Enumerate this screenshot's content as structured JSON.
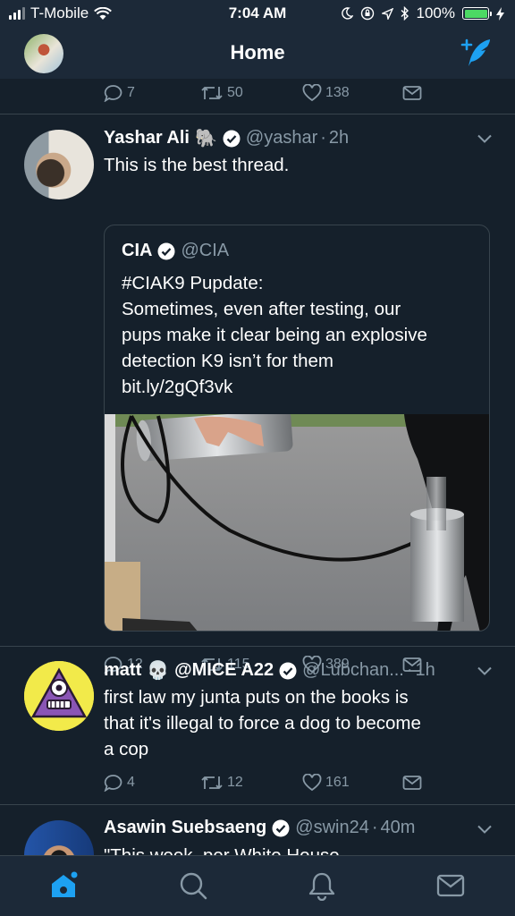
{
  "status_bar": {
    "carrier": "T-Mobile",
    "time": "7:04 AM",
    "battery": "100%"
  },
  "nav": {
    "title": "Home",
    "avatar": "profile-avatar",
    "compose_icon": "compose-tweet-icon"
  },
  "top_partial_actions": {
    "replies": "7",
    "retweets": "50",
    "likes": "138"
  },
  "tweets": [
    {
      "name": "Yashar Ali",
      "emoji": "🐘",
      "handle": "@yashar",
      "time": "2h",
      "text": "This is the best thread.",
      "quote": {
        "name": "CIA",
        "handle": "@CIA",
        "text_lines": [
          "#CIAK9 Pupdate:",
          "Sometimes, even after testing, our",
          "pups make it clear being an explosive",
          "detection K9 isn’t for them",
          "bit.ly/2gQf3vk"
        ]
      },
      "replies": "12",
      "retweets": "115",
      "likes": "389"
    },
    {
      "name": "matt",
      "emoji": "💀",
      "name2": "@MICE A22",
      "handle": "@Lubchan...",
      "time": "1h",
      "text_lines": [
        "first law my junta puts on the books is",
        "that it's illegal to force a dog to become",
        "a cop"
      ],
      "replies": "4",
      "retweets": "12",
      "likes": "161"
    },
    {
      "name": "Asawin Suebsaeng",
      "handle": "@swin24",
      "time": "40m",
      "text": "\"This week, per White House"
    }
  ],
  "tab_bar": [
    "home-icon",
    "search-icon",
    "notifications-icon",
    "messages-icon"
  ],
  "colors": {
    "background": "#15202b",
    "bar": "#1c2938",
    "accent": "#1da1f2",
    "muted": "#8899a6",
    "divider": "#38444d"
  }
}
